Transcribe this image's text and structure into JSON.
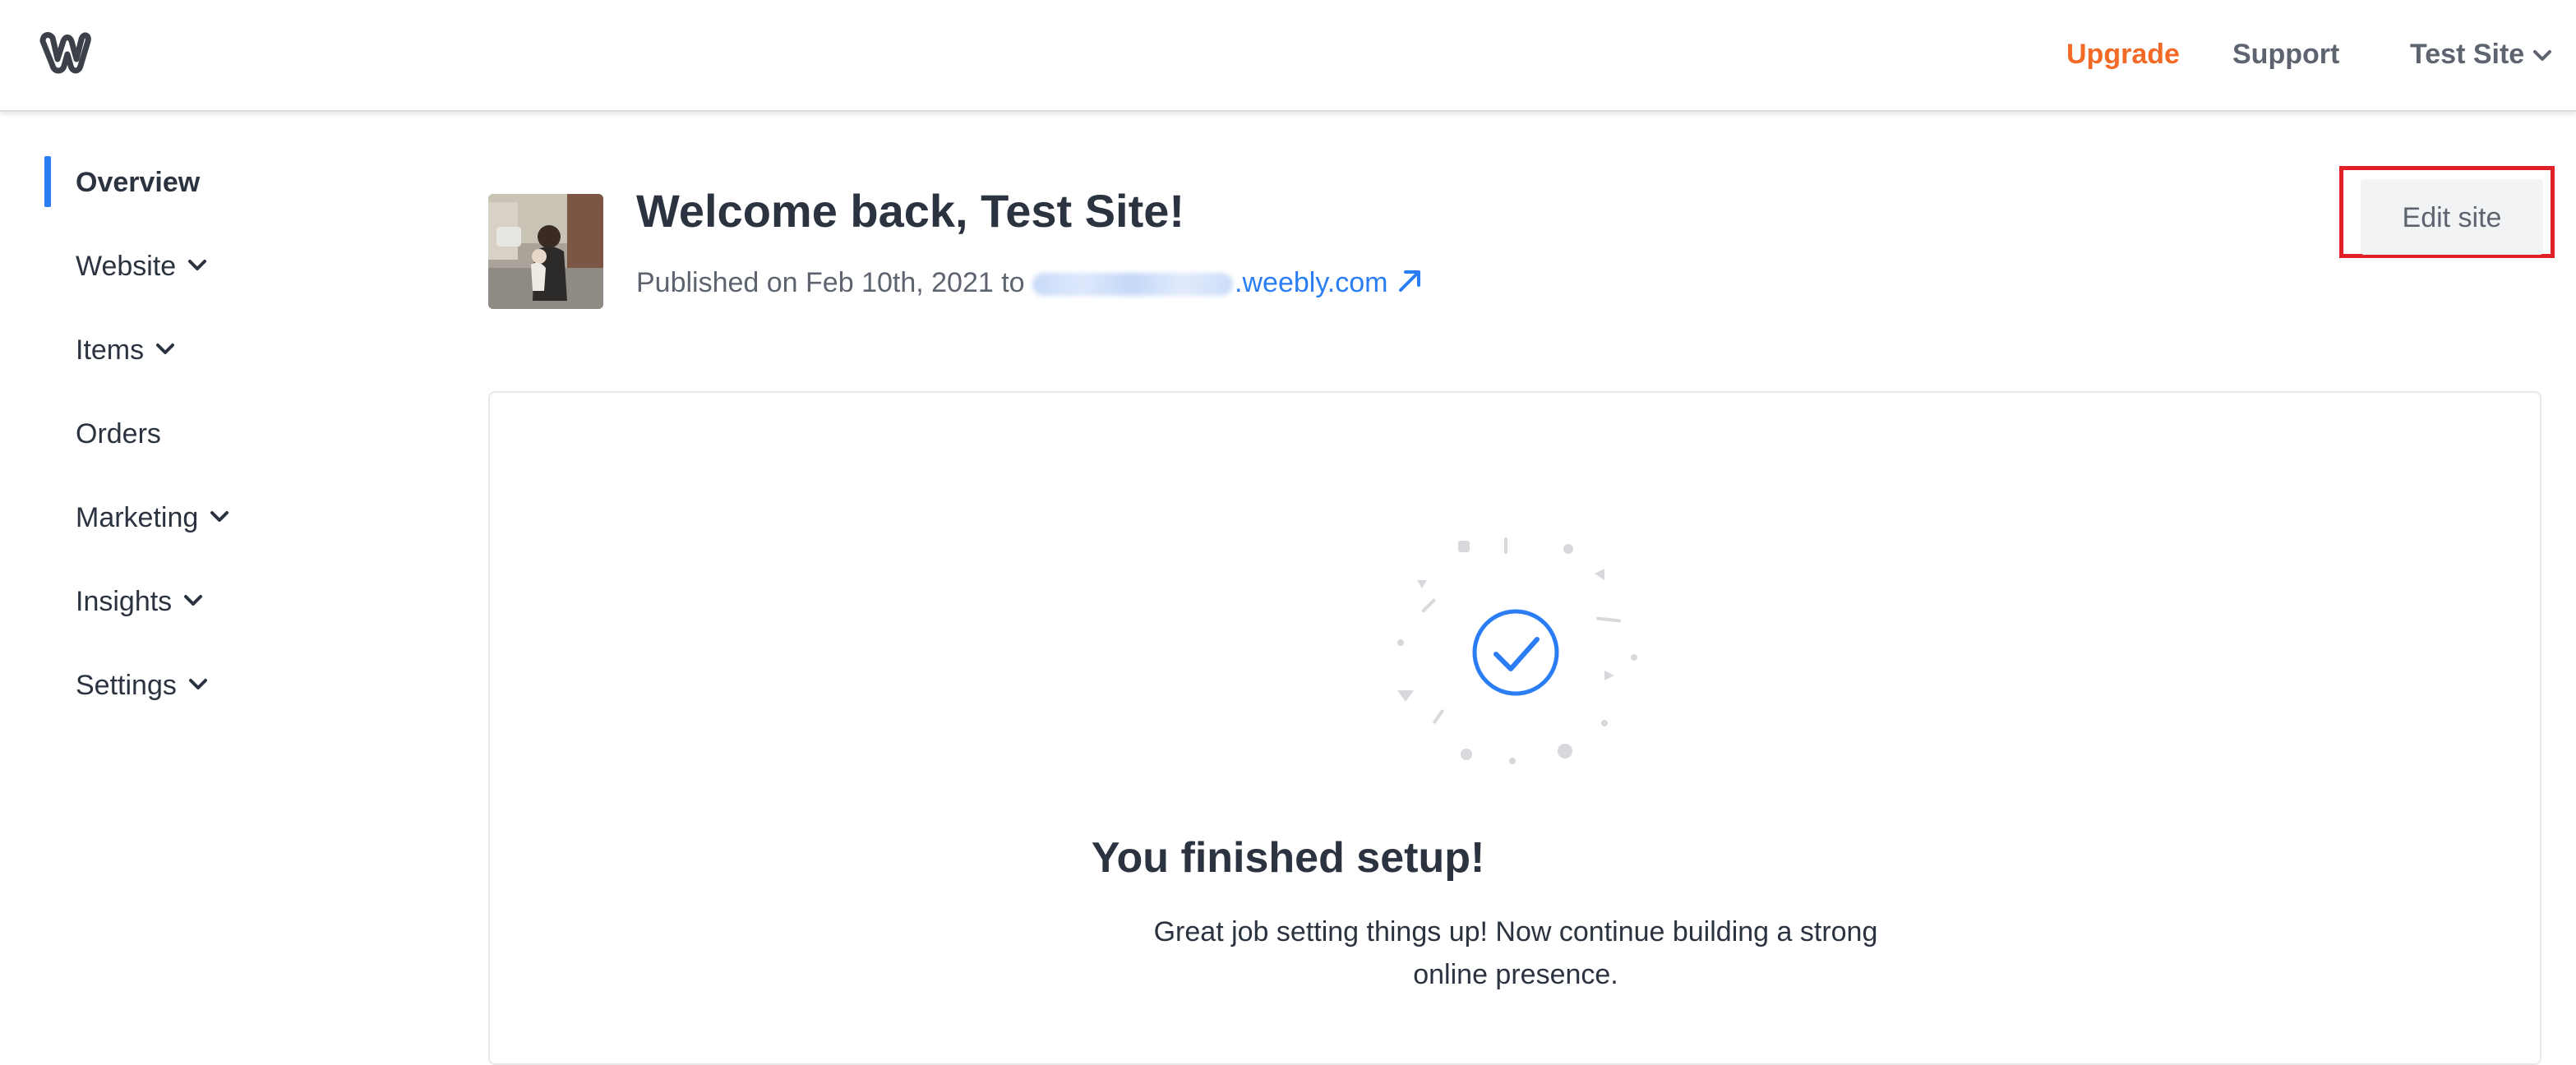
{
  "header": {
    "logo_icon": "weebly-w-logo-icon",
    "upgrade_label": "Upgrade",
    "support_label": "Support",
    "site_selector_label": "Test Site",
    "colors": {
      "upgrade": "#f26a25",
      "nav_text": "#5d6470"
    }
  },
  "sidebar": {
    "active_color": "#2b7df6",
    "items": [
      {
        "label": "Overview",
        "active": true,
        "has_dropdown": false
      },
      {
        "label": "Website",
        "active": false,
        "has_dropdown": true
      },
      {
        "label": "Items",
        "active": false,
        "has_dropdown": true
      },
      {
        "label": "Orders",
        "active": false,
        "has_dropdown": false
      },
      {
        "label": "Marketing",
        "active": false,
        "has_dropdown": true
      },
      {
        "label": "Insights",
        "active": false,
        "has_dropdown": true
      },
      {
        "label": "Settings",
        "active": false,
        "has_dropdown": true
      }
    ]
  },
  "main": {
    "welcome_title": "Welcome back, Test Site!",
    "published_prefix": "Published on Feb 10th, 2021 to",
    "site_domain_suffix": ".weebly.com",
    "edit_site_label": "Edit site",
    "setup": {
      "title": "You finished setup!",
      "description": "Great job setting things up! Now continue building a strong online presence."
    },
    "link_color": "#2b7df6",
    "accent_highlight_color": "#e01f26"
  }
}
